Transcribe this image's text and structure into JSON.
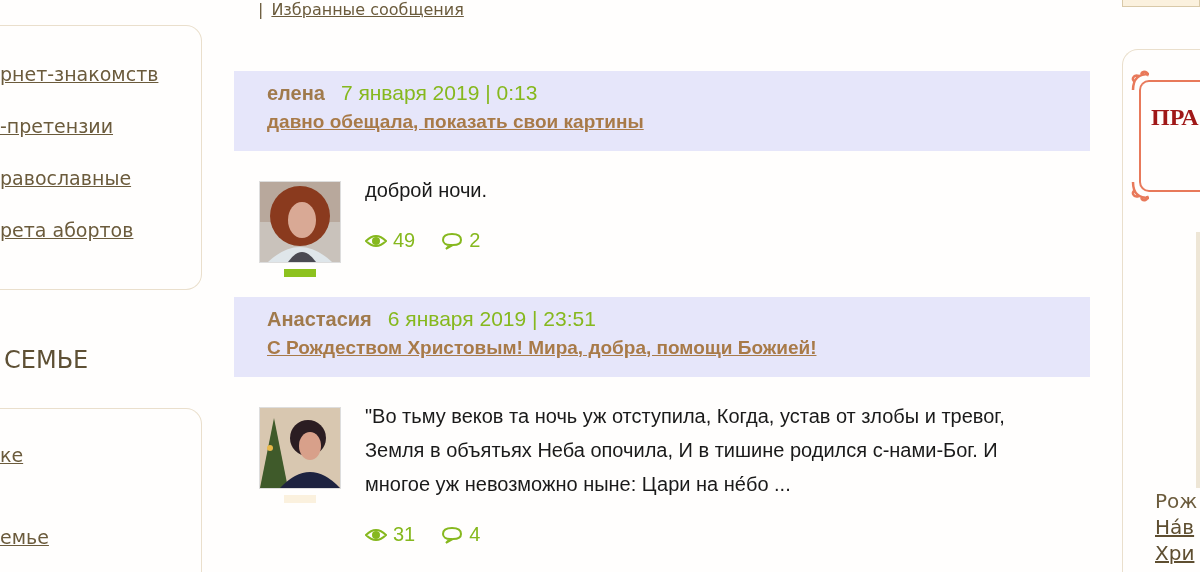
{
  "left_sidebar": {
    "links": [
      "рнет-знакомств",
      "-претензии",
      "равославные",
      "рета абортов"
    ],
    "section_title": "СЕМЬЕ",
    "section_links": [
      "ке",
      "емье"
    ]
  },
  "top_links": {
    "separator": "|",
    "favorites": "Избранные сообщения"
  },
  "posts": [
    {
      "author": "елена",
      "date": "7 января 2019 | 0:13",
      "title": "давно обещала, показать свои картины",
      "text": "доброй ночи.",
      "views": "49",
      "comments": "2",
      "color": "#8dc21f"
    },
    {
      "author": "Анастасия",
      "date": "6 января 2019 | 23:51",
      "title": "С Рождеством Христовым! Мира, добра, помощи Божией!",
      "text": " \"Во тьму веков та ночь уж отступила, Когда, устав от злобы и тревог, Земля в объятьях Неба опочила, И в тишине родился с-нами-Бог. И многое уж невозможно ныне: Цари на не́бо ...",
      "views": "31",
      "comments": "4",
      "color": "#fbf1de"
    }
  ],
  "right_sidebar": {
    "banner_text": "ПРА",
    "lines": [
      "Рож",
      "На́в",
      "Хри"
    ]
  }
}
